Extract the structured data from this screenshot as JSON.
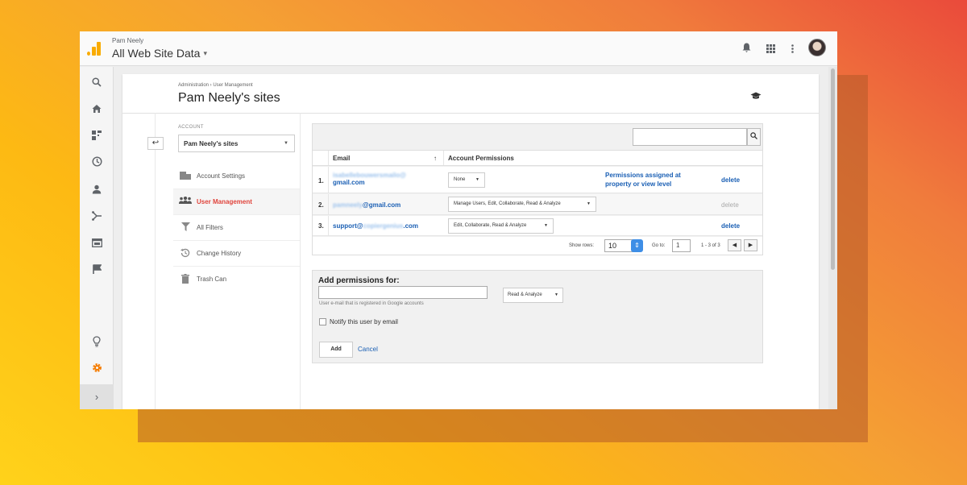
{
  "header": {
    "account_name": "Pam Neely",
    "property_name": "All Web Site Data",
    "property_caret": "▾"
  },
  "icons": {
    "bell": "🔔",
    "apps": "⋮⋮⋮",
    "more": "⋮"
  },
  "breadcrumb": "Administration › User Management",
  "page_title": "Pam Neely's sites",
  "account": {
    "label": "ACCOUNT",
    "selected": "Pam Neely's sites"
  },
  "menu": [
    {
      "label": "Account Settings",
      "icon": "building-icon"
    },
    {
      "label": "User Management",
      "icon": "people-icon",
      "active": true
    },
    {
      "label": "All Filters",
      "icon": "filter-icon"
    },
    {
      "label": "Change History",
      "icon": "history-icon"
    },
    {
      "label": "Trash Can",
      "icon": "trash-icon"
    }
  ],
  "table": {
    "headers": {
      "email": "Email",
      "permissions": "Account Permissions"
    },
    "rows": [
      {
        "num": "1.",
        "email_hidden": "isabellebouwersmailo@",
        "email_visible": "gmail.com",
        "permission": "None",
        "note": "Permissions assigned at property or view level",
        "action": "delete"
      },
      {
        "num": "2.",
        "email_hidden": "pamneely",
        "email_visible": "@gmail.com",
        "permission": "Manage Users, Edit, Collaborate, Read & Analyze",
        "action": "delete"
      },
      {
        "num": "3.",
        "email_prefix": "support@",
        "email_hidden": "copiergenius",
        "email_visible": ".com",
        "permission": "Edit, Collaborate, Read & Analyze",
        "action": "delete"
      }
    ],
    "footer": {
      "show_rows_label": "Show rows:",
      "show_rows_value": "10",
      "goto_label": "Go to:",
      "goto_value": "1",
      "range": "1 - 3 of 3"
    }
  },
  "add": {
    "title": "Add permissions for:",
    "hint": "User e-mail that is registered in Google accounts",
    "permission": "Read & Analyze",
    "notify_label": "Notify this user by email",
    "add_label": "Add",
    "cancel_label": "Cancel"
  }
}
